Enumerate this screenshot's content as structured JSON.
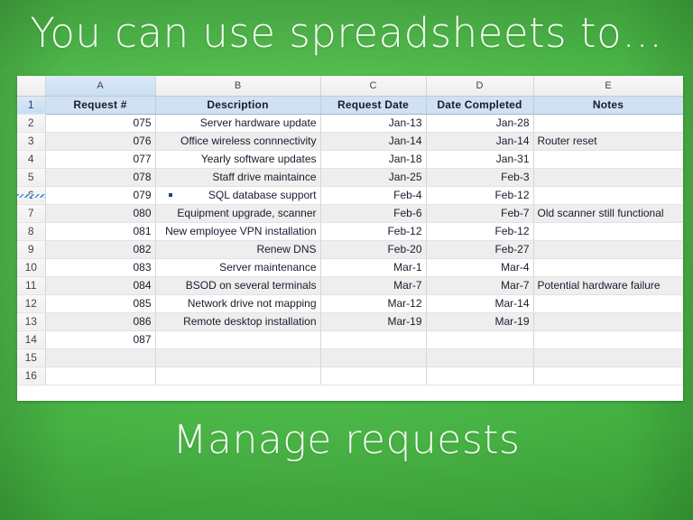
{
  "slide": {
    "title": "You can use spreadsheets to…",
    "caption": "Manage requests",
    "background_color": "#4eb84a",
    "title_color": "#f2fbf0"
  },
  "spreadsheet": {
    "corner_label": "",
    "column_letters": [
      "A",
      "B",
      "C",
      "D",
      "E"
    ],
    "header_fill_color": "#cfe1f2",
    "selected_row": "1",
    "row_numbers": [
      "1",
      "2",
      "3",
      "4",
      "5",
      "6",
      "7",
      "8",
      "9",
      "10",
      "11",
      "12",
      "13",
      "14",
      "15",
      "16"
    ],
    "headers": [
      "Request #",
      "Description",
      "Request Date",
      "Date Completed",
      "Notes"
    ],
    "rows": [
      {
        "num": "2",
        "request": "075",
        "description": "Server hardware update",
        "request_date": "Jan-13",
        "date_completed": "Jan-28",
        "notes": ""
      },
      {
        "num": "3",
        "request": "076",
        "description": "Office wireless connnectivity",
        "request_date": "Jan-14",
        "date_completed": "Jan-14",
        "notes": "Router reset"
      },
      {
        "num": "4",
        "request": "077",
        "description": "Yearly software updates",
        "request_date": "Jan-18",
        "date_completed": "Jan-31",
        "notes": ""
      },
      {
        "num": "5",
        "request": "078",
        "description": "Staff drive maintaince",
        "request_date": "Jan-25",
        "date_completed": "Feb-3",
        "notes": ""
      },
      {
        "num": "6",
        "request": "079",
        "description": "SQL database support",
        "request_date": "Feb-4",
        "date_completed": "Feb-12",
        "notes": ""
      },
      {
        "num": "7",
        "request": "080",
        "description": "Equipment upgrade, scanner",
        "request_date": "Feb-6",
        "date_completed": "Feb-7",
        "notes": "Old scanner still functional"
      },
      {
        "num": "8",
        "request": "081",
        "description": "New employee VPN installation",
        "request_date": "Feb-12",
        "date_completed": "Feb-12",
        "notes": ""
      },
      {
        "num": "9",
        "request": "082",
        "description": "Renew DNS",
        "request_date": "Feb-20",
        "date_completed": "Feb-27",
        "notes": ""
      },
      {
        "num": "10",
        "request": "083",
        "description": "Server maintenance",
        "request_date": "Mar-1",
        "date_completed": "Mar-4",
        "notes": ""
      },
      {
        "num": "11",
        "request": "084",
        "description": "BSOD on several terminals",
        "request_date": "Mar-7",
        "date_completed": "Mar-7",
        "notes": "Potential hardware failure"
      },
      {
        "num": "12",
        "request": "085",
        "description": "Network drive not mapping",
        "request_date": "Mar-12",
        "date_completed": "Mar-14",
        "notes": ""
      },
      {
        "num": "13",
        "request": "086",
        "description": "Remote desktop installation",
        "request_date": "Mar-19",
        "date_completed": "Mar-19",
        "notes": ""
      },
      {
        "num": "14",
        "request": "087",
        "description": "",
        "request_date": "",
        "date_completed": "",
        "notes": ""
      },
      {
        "num": "15",
        "request": "",
        "description": "",
        "request_date": "",
        "date_completed": "",
        "notes": ""
      },
      {
        "num": "16",
        "request": "",
        "description": "",
        "request_date": "",
        "date_completed": "",
        "notes": ""
      }
    ]
  }
}
